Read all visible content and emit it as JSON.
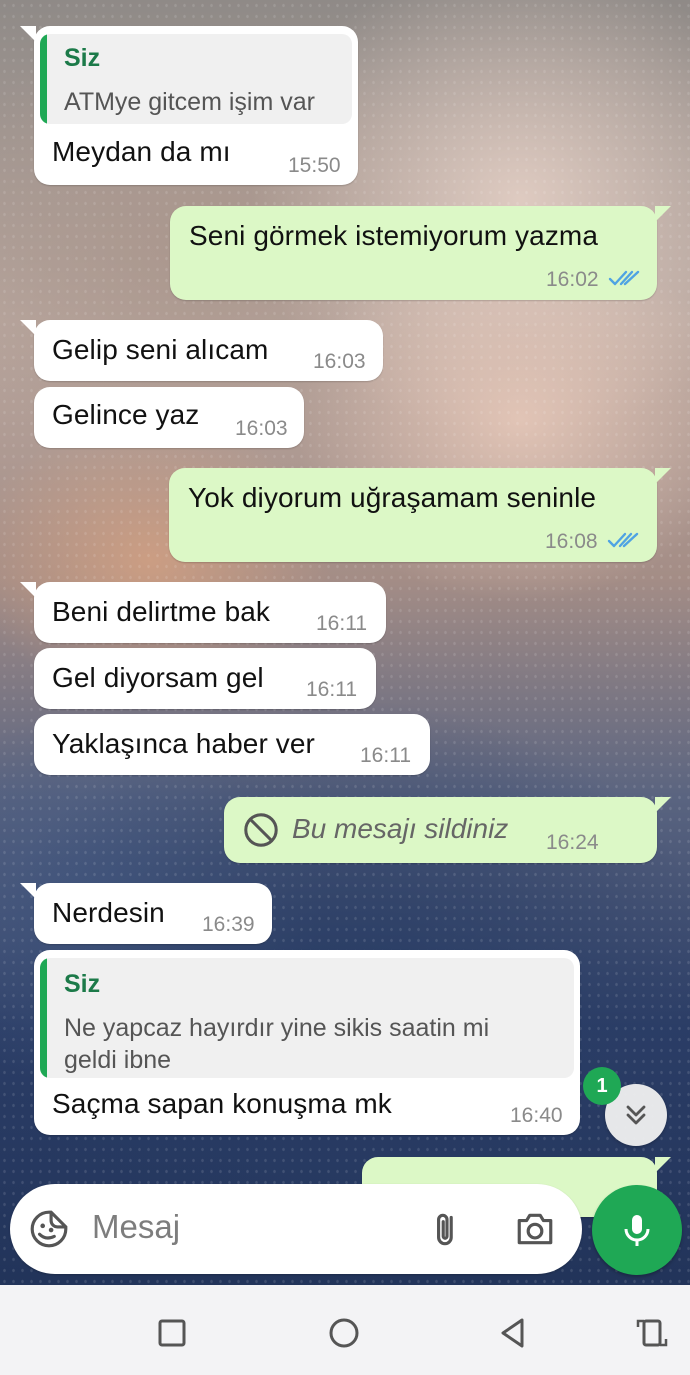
{
  "messages": [
    {
      "id": "m1",
      "dir": "in",
      "quote": {
        "name": "Siz",
        "text": "ATMye gitcem işim var"
      },
      "text": "Meydan da mı",
      "time": "15:50"
    },
    {
      "id": "m2",
      "dir": "out",
      "text": "Seni görmek istemiyorum yazma",
      "time": "16:02",
      "status": "read"
    },
    {
      "id": "m3",
      "dir": "in",
      "text": "Gelip seni alıcam",
      "time": "16:03"
    },
    {
      "id": "m4",
      "dir": "in",
      "text": "Gelince yaz",
      "time": "16:03"
    },
    {
      "id": "m5",
      "dir": "out",
      "text": "Yok diyorum uğraşamam seninle",
      "time": "16:08",
      "status": "read"
    },
    {
      "id": "m6",
      "dir": "in",
      "text": "Beni delirtme bak",
      "time": "16:11"
    },
    {
      "id": "m7",
      "dir": "in",
      "text": "Gel diyorsam gel",
      "time": "16:11"
    },
    {
      "id": "m8",
      "dir": "in",
      "text": "Yaklaşınca haber ver",
      "time": "16:11"
    },
    {
      "id": "m9",
      "dir": "out",
      "deleted": true,
      "text": "Bu mesajı sildiniz",
      "time": "16:24"
    },
    {
      "id": "m10",
      "dir": "in",
      "text": "Nerdesin",
      "time": "16:39"
    },
    {
      "id": "m11",
      "dir": "in",
      "quote": {
        "name": "Siz",
        "text_line1": "Ne yapcaz hayırdır yine sikis saatin mi",
        "text_line2": "geldi ibne"
      },
      "text": "Saçma sapan konuşma mk",
      "time": "16:40"
    }
  ],
  "composer": {
    "placeholder": "Mesaj",
    "icons": [
      "emoji-sticker-icon",
      "attach-icon",
      "camera-icon",
      "mic-icon"
    ]
  },
  "scroll_down": {
    "unread_count": "1"
  },
  "navbar": {
    "icons": [
      "recents-icon",
      "home-icon",
      "back-icon",
      "rotate-icon"
    ]
  },
  "colors": {
    "incoming_bubble": "#ffffff",
    "outgoing_bubble": "#dcf8c6",
    "accent_green": "#1fa855",
    "read_ticks": "#4fa3e3"
  }
}
